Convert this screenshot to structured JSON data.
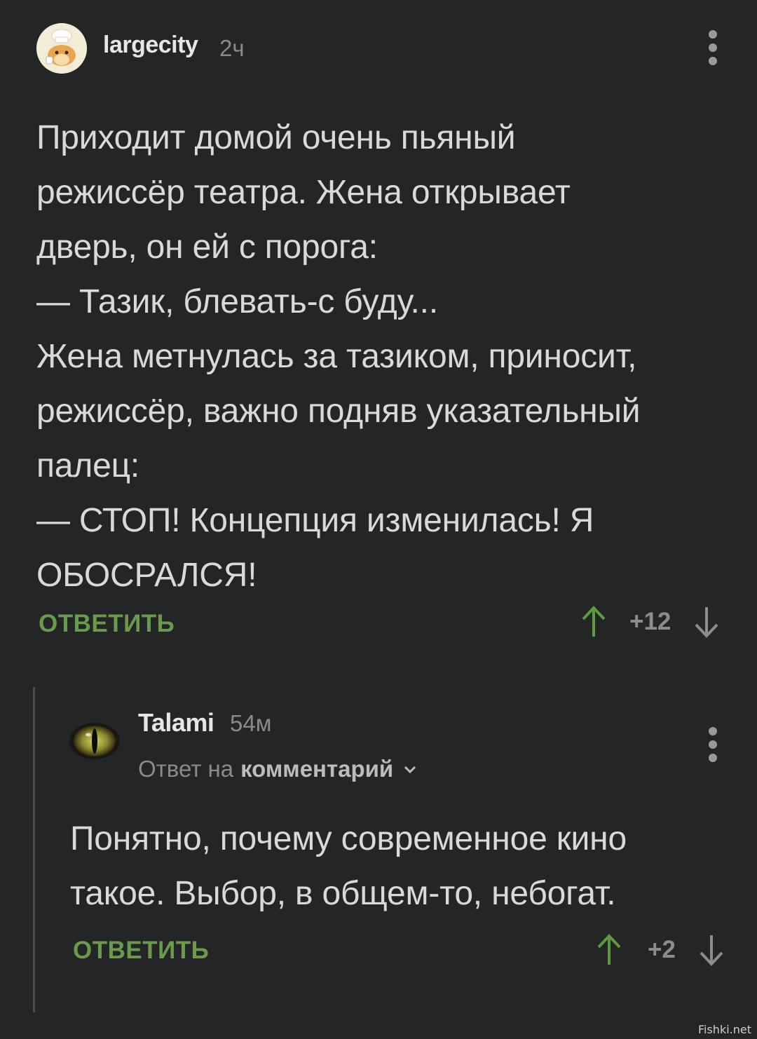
{
  "comments": [
    {
      "author": "largecity",
      "time": "2ч",
      "avatar_icon": "hamster-chef-avatar",
      "text": "Приходит домой очень пьяный\nрежиссёр театра. Жена открывает\nдверь, он ей с порога:\n— Тазик, блевать-с буду...\nЖена метнулась за тазиком, приносит,\nрежиссёр, важно подняв указательный\nпалец:\n— СТОП! Концепция изменилась! Я\nОБОСРАЛСЯ!",
      "reply_label": "ОТВЕТИТЬ",
      "score": "+12"
    },
    {
      "author": "Talami",
      "time": "54м",
      "avatar_icon": "cat-eye-avatar",
      "reply_to_prefix": "Ответ на",
      "reply_to_target": "комментарий",
      "text": "Понятно, почему современное кино\nтакое. Выбор, в общем-то, небогат.",
      "reply_label": "ОТВЕТИТЬ",
      "score": "+2"
    }
  ],
  "colors": {
    "background": "#232527",
    "accent_green": "#6a9a4b",
    "muted": "#8a8a8a"
  },
  "watermark": "Fishki.net"
}
